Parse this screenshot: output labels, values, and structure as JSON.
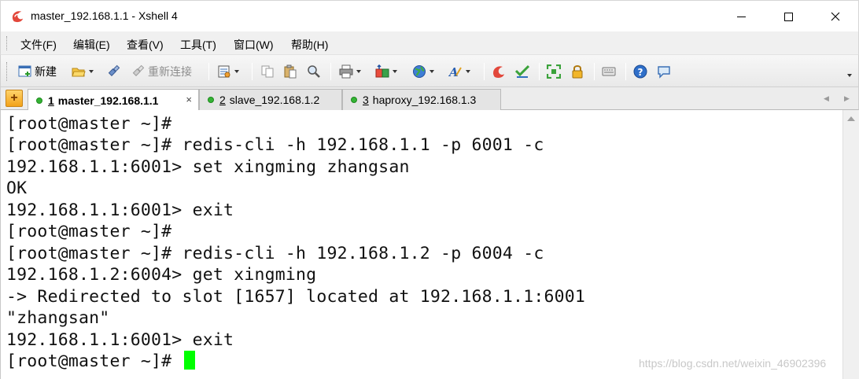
{
  "window": {
    "title": "master_192.168.1.1 - Xshell 4"
  },
  "menu": {
    "items": [
      "文件(F)",
      "编辑(E)",
      "查看(V)",
      "工具(T)",
      "窗口(W)",
      "帮助(H)"
    ]
  },
  "toolbar": {
    "new_label": "新建",
    "reconnect_label": "重新连接"
  },
  "tabs": [
    {
      "number": "1",
      "label": "master_192.168.1.1",
      "active": true,
      "close": "×"
    },
    {
      "number": "2",
      "label": "slave_192.168.1.2",
      "active": false
    },
    {
      "number": "3",
      "label": "haproxy_192.168.1.3",
      "active": false
    }
  ],
  "terminal": {
    "lines": [
      "[root@master ~]#",
      "[root@master ~]# redis-cli -h 192.168.1.1 -p 6001 -c",
      "192.168.1.1:6001> set xingming zhangsan",
      "OK",
      "192.168.1.1:6001> exit",
      "[root@master ~]#",
      "[root@master ~]# redis-cli -h 192.168.1.2 -p 6004 -c",
      "192.168.1.2:6004> get xingming",
      "-> Redirected to slot [1657] located at 192.168.1.1:6001",
      "\"zhangsan\"",
      "192.168.1.1:6001> exit",
      "[root@master ~]# "
    ],
    "cursor_color": "#00ff00"
  },
  "watermark": "https://blog.csdn.net/weixin_46902396",
  "colors": {
    "terminal_bg": "#ffffff",
    "terminal_fg": "#111111",
    "session_dot": "#34b334"
  }
}
